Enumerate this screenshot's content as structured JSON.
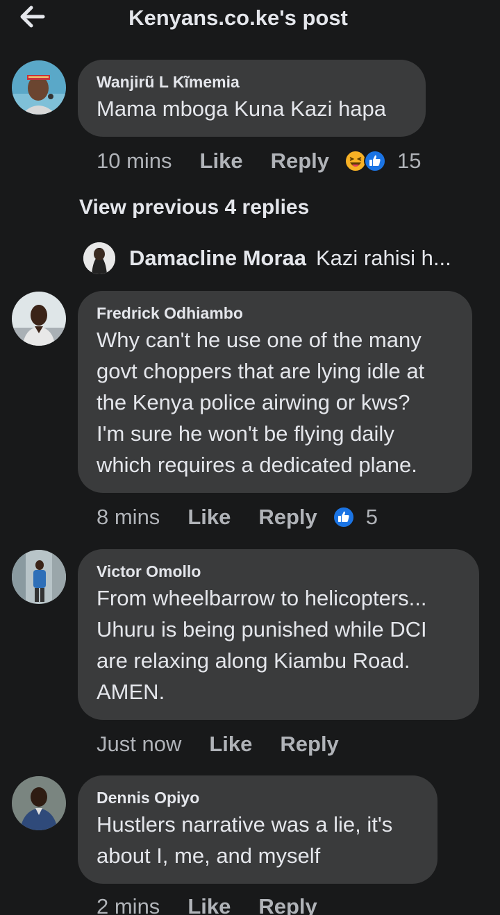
{
  "header": {
    "title": "Kenyans.co.ke's post",
    "back_icon": "arrow-left-icon"
  },
  "comments": [
    {
      "author": "Wanjirũ L Kĩmemia",
      "text": "Mama mboga Kuna Kazi hapa",
      "time": "10 mins",
      "like_label": "Like",
      "reply_label": "Reply",
      "reactions": [
        "haha-icon",
        "like-icon"
      ],
      "reaction_count": "15"
    },
    {
      "author": "Fredrick Odhiambo",
      "text": "Why can't he use one of the many\ngovt choppers that are lying idle at\nthe Kenya police airwing or kws?\nI'm sure he won't be flying daily\nwhich requires a dedicated plane.",
      "time": "8 mins",
      "like_label": "Like",
      "reply_label": "Reply",
      "reactions": [
        "like-icon"
      ],
      "reaction_count": "5"
    },
    {
      "author": "Victor Omollo",
      "text": "From wheelbarrow to helicopters...\nUhuru is being punished while DCI\nare relaxing along Kiambu Road.\nAMEN.",
      "time": "Just now",
      "like_label": "Like",
      "reply_label": "Reply"
    },
    {
      "author": "Dennis Opiyo",
      "text": "Hustlers narrative was a lie, it's\nabout I, me, and myself",
      "time": "2 mins",
      "like_label": "Like",
      "reply_label": "Reply"
    }
  ],
  "view_previous": "View previous 4 replies",
  "reply_preview": {
    "author": "Damacline Moraa",
    "text": "Kazi rahisi h..."
  },
  "colors": {
    "background": "#18191a",
    "bubble": "#3a3b3c",
    "text_primary": "#e4e6eb",
    "text_secondary": "#b0b3b8",
    "like_blue": "#1b74e4",
    "haha_yellow": "#f7b125"
  }
}
